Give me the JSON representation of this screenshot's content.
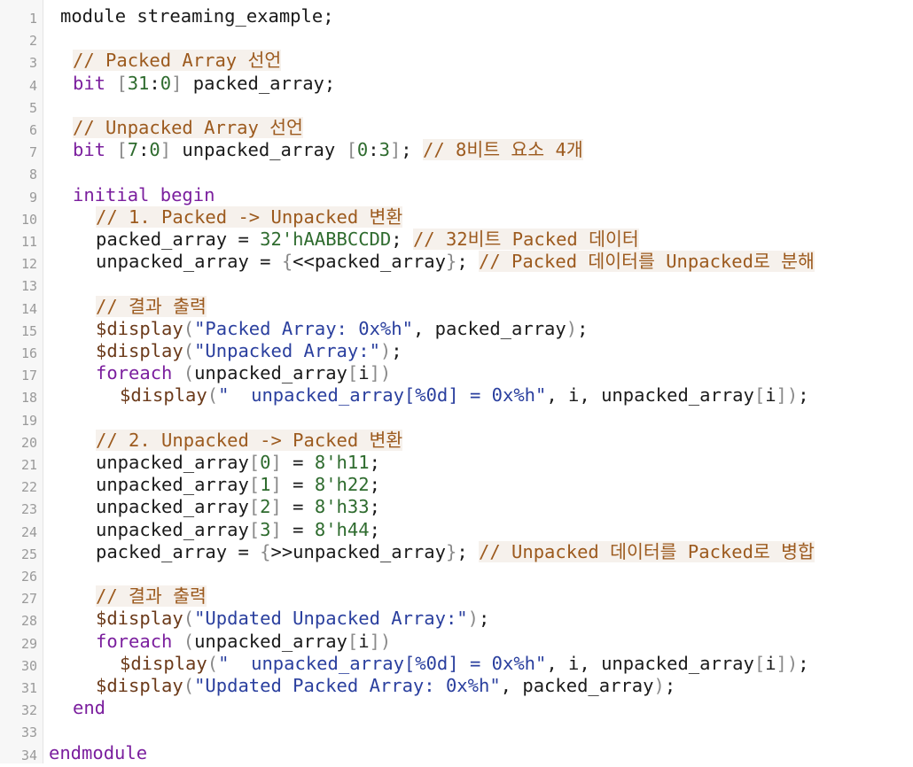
{
  "editor": {
    "lines": [
      [
        {
          "t": "module streaming_example;",
          "c": ""
        }
      ],
      [],
      [
        {
          "t": "// Packed Array 선언",
          "c": "cm"
        }
      ],
      [
        {
          "t": "bit",
          "c": "kw"
        },
        {
          "t": " ",
          "c": ""
        },
        {
          "t": "[",
          "c": "br"
        },
        {
          "t": "31",
          "c": "num"
        },
        {
          "t": ":",
          "c": ""
        },
        {
          "t": "0",
          "c": "num"
        },
        {
          "t": "]",
          "c": "br"
        },
        {
          "t": " packed_array;",
          "c": ""
        }
      ],
      [],
      [
        {
          "t": "// Unpacked Array 선언",
          "c": "cm"
        }
      ],
      [
        {
          "t": "bit",
          "c": "kw"
        },
        {
          "t": " ",
          "c": ""
        },
        {
          "t": "[",
          "c": "br"
        },
        {
          "t": "7",
          "c": "num"
        },
        {
          "t": ":",
          "c": ""
        },
        {
          "t": "0",
          "c": "num"
        },
        {
          "t": "]",
          "c": "br"
        },
        {
          "t": " unpacked_array ",
          "c": ""
        },
        {
          "t": "[",
          "c": "br"
        },
        {
          "t": "0",
          "c": "num"
        },
        {
          "t": ":",
          "c": ""
        },
        {
          "t": "3",
          "c": "num"
        },
        {
          "t": "]",
          "c": "br"
        },
        {
          "t": "; ",
          "c": ""
        },
        {
          "t": "// 8비트 요소 4개",
          "c": "cm"
        }
      ],
      [],
      [
        {
          "t": "initial begin",
          "c": "kw"
        }
      ],
      [
        {
          "t": "// 1. Packed -> Unpacked 변환",
          "c": "cm"
        }
      ],
      [
        {
          "t": "packed_array = ",
          "c": ""
        },
        {
          "t": "32'hAABBCCDD",
          "c": "num"
        },
        {
          "t": "; ",
          "c": ""
        },
        {
          "t": "// 32비트 Packed 데이터",
          "c": "cm"
        }
      ],
      [
        {
          "t": "unpacked_array = ",
          "c": ""
        },
        {
          "t": "{",
          "c": "br"
        },
        {
          "t": "<<packed_array",
          "c": ""
        },
        {
          "t": "}",
          "c": "br"
        },
        {
          "t": "; ",
          "c": ""
        },
        {
          "t": "// Packed 데이터를 Unpacked로 분해",
          "c": "cm"
        }
      ],
      [],
      [
        {
          "t": "// 결과 출력",
          "c": "cm"
        }
      ],
      [
        {
          "t": "$display",
          "c": "fn"
        },
        {
          "t": "(",
          "c": "br"
        },
        {
          "t": "\"Packed Array: 0x%h\"",
          "c": "str"
        },
        {
          "t": ", packed_array",
          "c": ""
        },
        {
          "t": ")",
          "c": "br"
        },
        {
          "t": ";",
          "c": ""
        }
      ],
      [
        {
          "t": "$display",
          "c": "fn"
        },
        {
          "t": "(",
          "c": "br"
        },
        {
          "t": "\"Unpacked Array:\"",
          "c": "str"
        },
        {
          "t": ")",
          "c": "br"
        },
        {
          "t": ";",
          "c": ""
        }
      ],
      [
        {
          "t": "foreach",
          "c": "kw"
        },
        {
          "t": " ",
          "c": ""
        },
        {
          "t": "(",
          "c": "br"
        },
        {
          "t": "unpacked_array",
          "c": ""
        },
        {
          "t": "[",
          "c": "br"
        },
        {
          "t": "i",
          "c": ""
        },
        {
          "t": "]",
          "c": "br"
        },
        {
          "t": ")",
          "c": "br"
        }
      ],
      [
        {
          "t": "$display",
          "c": "fn"
        },
        {
          "t": "(",
          "c": "br"
        },
        {
          "t": "\"  unpacked_array[%0d] = 0x%h\"",
          "c": "str"
        },
        {
          "t": ", i, unpacked_array",
          "c": ""
        },
        {
          "t": "[",
          "c": "br"
        },
        {
          "t": "i",
          "c": ""
        },
        {
          "t": "]",
          "c": "br"
        },
        {
          "t": ")",
          "c": "br"
        },
        {
          "t": ";",
          "c": ""
        }
      ],
      [],
      [
        {
          "t": "// 2. Unpacked -> Packed 변환",
          "c": "cm"
        }
      ],
      [
        {
          "t": "unpacked_array",
          "c": ""
        },
        {
          "t": "[",
          "c": "br"
        },
        {
          "t": "0",
          "c": "num"
        },
        {
          "t": "]",
          "c": "br"
        },
        {
          "t": " = ",
          "c": ""
        },
        {
          "t": "8'h11",
          "c": "num"
        },
        {
          "t": ";",
          "c": ""
        }
      ],
      [
        {
          "t": "unpacked_array",
          "c": ""
        },
        {
          "t": "[",
          "c": "br"
        },
        {
          "t": "1",
          "c": "num"
        },
        {
          "t": "]",
          "c": "br"
        },
        {
          "t": " = ",
          "c": ""
        },
        {
          "t": "8'h22",
          "c": "num"
        },
        {
          "t": ";",
          "c": ""
        }
      ],
      [
        {
          "t": "unpacked_array",
          "c": ""
        },
        {
          "t": "[",
          "c": "br"
        },
        {
          "t": "2",
          "c": "num"
        },
        {
          "t": "]",
          "c": "br"
        },
        {
          "t": " = ",
          "c": ""
        },
        {
          "t": "8'h33",
          "c": "num"
        },
        {
          "t": ";",
          "c": ""
        }
      ],
      [
        {
          "t": "unpacked_array",
          "c": ""
        },
        {
          "t": "[",
          "c": "br"
        },
        {
          "t": "3",
          "c": "num"
        },
        {
          "t": "]",
          "c": "br"
        },
        {
          "t": " = ",
          "c": ""
        },
        {
          "t": "8'h44",
          "c": "num"
        },
        {
          "t": ";",
          "c": ""
        }
      ],
      [
        {
          "t": "packed_array = ",
          "c": ""
        },
        {
          "t": "{",
          "c": "br"
        },
        {
          "t": ">>unpacked_array",
          "c": ""
        },
        {
          "t": "}",
          "c": "br"
        },
        {
          "t": "; ",
          "c": ""
        },
        {
          "t": "// Unpacked 데이터를 Packed로 병합",
          "c": "cm"
        }
      ],
      [],
      [
        {
          "t": "// 결과 출력",
          "c": "cm"
        }
      ],
      [
        {
          "t": "$display",
          "c": "fn"
        },
        {
          "t": "(",
          "c": "br"
        },
        {
          "t": "\"Updated Unpacked Array:\"",
          "c": "str"
        },
        {
          "t": ")",
          "c": "br"
        },
        {
          "t": ";",
          "c": ""
        }
      ],
      [
        {
          "t": "foreach",
          "c": "kw"
        },
        {
          "t": " ",
          "c": ""
        },
        {
          "t": "(",
          "c": "br"
        },
        {
          "t": "unpacked_array",
          "c": ""
        },
        {
          "t": "[",
          "c": "br"
        },
        {
          "t": "i",
          "c": ""
        },
        {
          "t": "]",
          "c": "br"
        },
        {
          "t": ")",
          "c": "br"
        }
      ],
      [
        {
          "t": "$display",
          "c": "fn"
        },
        {
          "t": "(",
          "c": "br"
        },
        {
          "t": "\"  unpacked_array[%0d] = 0x%h\"",
          "c": "str"
        },
        {
          "t": ", i, unpacked_array",
          "c": ""
        },
        {
          "t": "[",
          "c": "br"
        },
        {
          "t": "i",
          "c": ""
        },
        {
          "t": "]",
          "c": "br"
        },
        {
          "t": ")",
          "c": "br"
        },
        {
          "t": ";",
          "c": ""
        }
      ],
      [
        {
          "t": "$display",
          "c": "fn"
        },
        {
          "t": "(",
          "c": "br"
        },
        {
          "t": "\"Updated Packed Array: 0x%h\"",
          "c": "str"
        },
        {
          "t": ", packed_array",
          "c": ""
        },
        {
          "t": ")",
          "c": "br"
        },
        {
          "t": ";",
          "c": ""
        }
      ],
      [
        {
          "t": "end",
          "c": "kw"
        }
      ],
      [],
      [
        {
          "t": "endmodule",
          "c": "kw"
        }
      ]
    ]
  },
  "colors": {
    "keyword": "#7b1f9e",
    "comment": "#9c5a1e",
    "number": "#2e6b2e",
    "string": "#2a3f9e"
  }
}
